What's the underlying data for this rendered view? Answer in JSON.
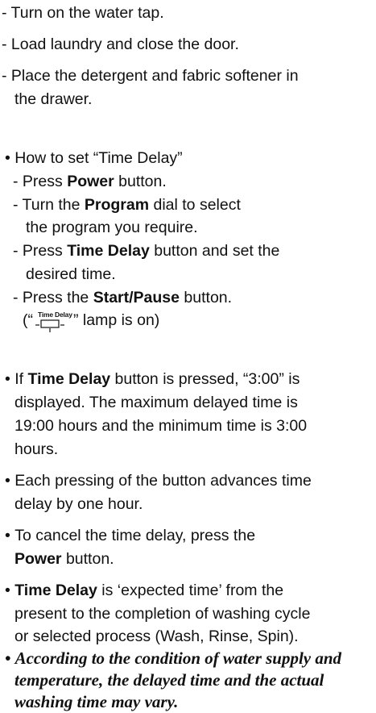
{
  "steps_top": [
    "- Turn on the water tap.",
    "- Load laundry and close the door.",
    "- Place the detergent and fabric softener in",
    "the drawer."
  ],
  "how_to": {
    "heading": "How to set “Time Delay”",
    "s1_pre": "- Press ",
    "s1_bold": "Power",
    "s1_post": " button.",
    "s2_pre": "- Turn the ",
    "s2_bold": "Program",
    "s2_post": " dial to select",
    "s2_cont": "the program you require.",
    "s3_pre": "- Press ",
    "s3_bold": "Time Delay",
    "s3_post": " button and set the",
    "s3_cont": "desired time.",
    "s4_pre": "- Press the ",
    "s4_bold": "Start/Pause",
    "s4_post": " button.",
    "lamp_open": "(“",
    "lamp_label": "Time Delay",
    "lamp_close": "” lamp is on)"
  },
  "notes": {
    "n1_pre": "If ",
    "n1_bold": "Time Delay",
    "n1_post": " button is pressed, “3:00” is",
    "n1_l2": "displayed. The maximum delayed time is",
    "n1_l3": "19:00 hours and the minimum time is 3:00",
    "n1_l4": "hours.",
    "n2_l1": "Each pressing of the button advances time",
    "n2_l2": "delay by one hour.",
    "n3_l1": "To cancel the time delay, press the",
    "n3_bold": "Power",
    "n3_post": " button.",
    "n4_bold": "Time Delay",
    "n4_post": " is ‘expected time’ from the",
    "n4_l2": "present to the completion of washing cycle",
    "n4_l3": "or selected process (Wash, Rinse, Spin)."
  },
  "warning": {
    "l1": "According to the condition of water supply and",
    "l2": "temperature, the delayed time and the actual",
    "l3": "washing time may vary."
  },
  "bullet": "•"
}
